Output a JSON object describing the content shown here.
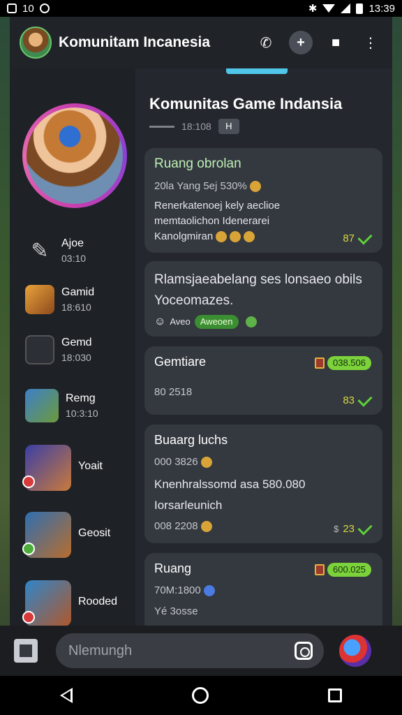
{
  "statusbar": {
    "left_text": "10",
    "time": "13:39"
  },
  "header": {
    "title": "Komunitam Incanesia"
  },
  "sidebar": {
    "items": [
      {
        "name": "Ajoe",
        "time": "03:10"
      },
      {
        "name": "Gamid",
        "time": "18:610"
      },
      {
        "name": "Gemd",
        "time": "18:030"
      },
      {
        "name": "Remg",
        "time": "10:3:10"
      },
      {
        "name": "Yoait",
        "time": ""
      },
      {
        "name": "Geosit",
        "time": ""
      },
      {
        "name": "Rooded",
        "time": ""
      }
    ]
  },
  "chat": {
    "title": "Komunitas Game Indansia",
    "subtitle": "18:108",
    "tag": "H",
    "cards": [
      {
        "title": "Ruang obrolan",
        "lines": [
          "20la Yang 5ej 530%",
          "Renerkatenoej kely aeclioe",
          "memtaolichon Idenerarei",
          "Kanolgmiran"
        ],
        "score": "87"
      },
      {
        "title": "Rlamsjaeabelang ses lonsaeo obils",
        "line2": "Yoceomazes.",
        "meta": "Aveo",
        "pill": "Aweoen"
      },
      {
        "title": "Gemtiare",
        "badge": "038.506",
        "line": "80 2518",
        "score": "83"
      },
      {
        "title": "Buaarg luchs",
        "lines": [
          "000 3826",
          "Knenhralssomd asa 580.080",
          "Iorsarleunich",
          "008 2208"
        ],
        "score": "23",
        "score_prefix": "$"
      },
      {
        "title": "Ruang",
        "badge": "600.025",
        "lines": [
          "70M:1800",
          "Yé 3osse"
        ]
      }
    ]
  },
  "input": {
    "placeholder": "Nlemungh"
  }
}
